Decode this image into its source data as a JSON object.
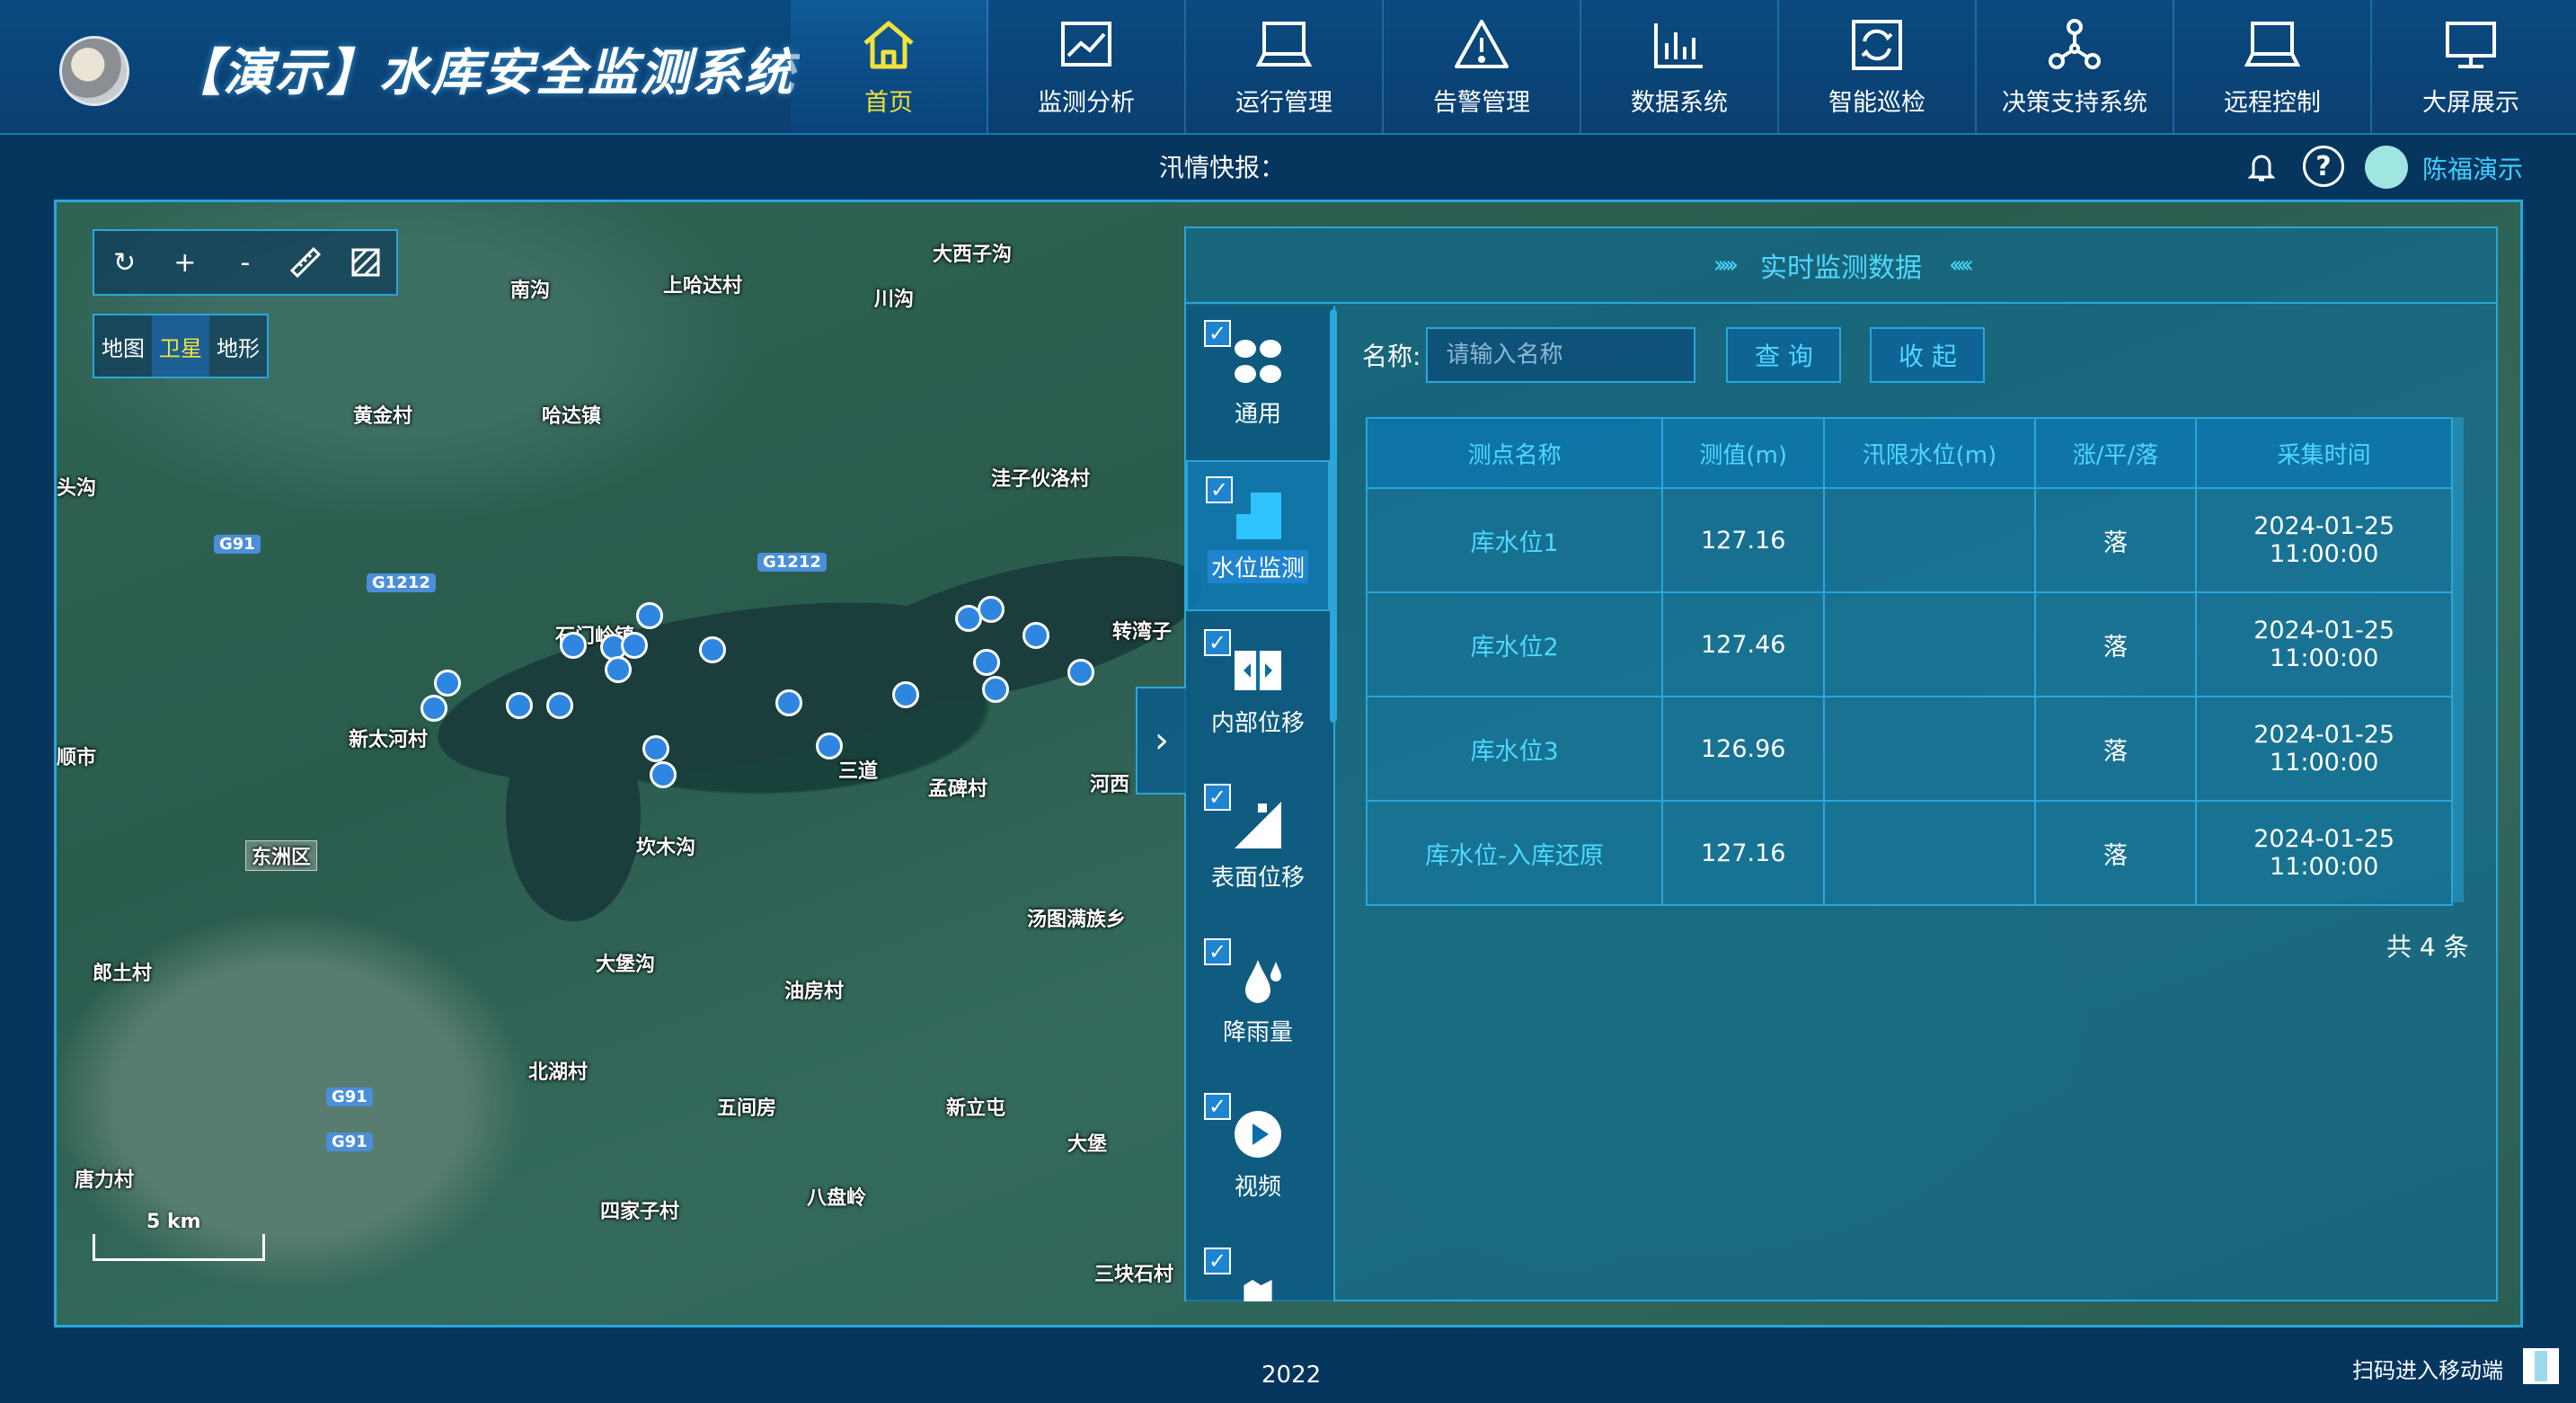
{
  "app": {
    "title": "【演示】水库安全监测系统"
  },
  "nav": [
    {
      "label": "首页",
      "icon": "home-icon",
      "active": true
    },
    {
      "label": "监测分析",
      "icon": "line-chart-icon"
    },
    {
      "label": "运行管理",
      "icon": "laptop-icon"
    },
    {
      "label": "告警管理",
      "icon": "warning-icon"
    },
    {
      "label": "数据系统",
      "icon": "bar-chart-icon"
    },
    {
      "label": "智能巡检",
      "icon": "refresh-icon"
    },
    {
      "label": "决策支持系统",
      "icon": "network-icon"
    },
    {
      "label": "远程控制",
      "icon": "laptop-icon"
    },
    {
      "label": "大屏展示",
      "icon": "monitor-icon"
    }
  ],
  "subbar": {
    "flood_label": "汛情快报：",
    "help_glyph": "?",
    "username": "陈福演示"
  },
  "map": {
    "tools": [
      "↻",
      "+",
      "-"
    ],
    "layers": [
      "地图",
      "卫星",
      "地形"
    ],
    "active_layer": "卫星",
    "scale": "5 km",
    "places": [
      {
        "name": "南沟"
      },
      {
        "name": "上哈达村"
      },
      {
        "name": "大西子沟"
      },
      {
        "name": "川沟"
      },
      {
        "name": "黄金村"
      },
      {
        "name": "哈达镇"
      },
      {
        "name": "洼子伙洛村"
      },
      {
        "name": "头沟"
      },
      {
        "name": "石门岭镇"
      },
      {
        "name": "转湾子"
      },
      {
        "name": "新太河村"
      },
      {
        "name": "三道"
      },
      {
        "name": "孟碑村"
      },
      {
        "name": "河西"
      },
      {
        "name": "东洲区"
      },
      {
        "name": "坎木沟"
      },
      {
        "name": "汤图满族乡"
      },
      {
        "name": "顺市"
      },
      {
        "name": "郎土村"
      },
      {
        "name": "大堡沟"
      },
      {
        "name": "油房村"
      },
      {
        "name": "北湖村"
      },
      {
        "name": "五间房"
      },
      {
        "name": "新立屯"
      },
      {
        "name": "大堡"
      },
      {
        "name": "八盘岭"
      },
      {
        "name": "四家子村"
      },
      {
        "name": "唐力村"
      },
      {
        "name": "三块石村"
      }
    ],
    "roads": [
      "G91",
      "G1212",
      "G1212",
      "G91",
      "G91"
    ]
  },
  "panel": {
    "title": "实时监测数据",
    "toggle_glyph": "›",
    "layer_items": [
      {
        "label": "通用",
        "icon": "grid-icon",
        "checked": true
      },
      {
        "label": "水位监测",
        "icon": "water-level-icon",
        "checked": true,
        "active": true
      },
      {
        "label": "内部位移",
        "icon": "internal-displacement-icon",
        "checked": true
      },
      {
        "label": "表面位移",
        "icon": "surface-displacement-icon",
        "checked": true
      },
      {
        "label": "降雨量",
        "icon": "rainfall-icon",
        "checked": true
      },
      {
        "label": "视频",
        "icon": "play-icon",
        "checked": true
      },
      {
        "label": "",
        "icon": "seepage-icon",
        "checked": true
      }
    ],
    "search": {
      "label": "名称:",
      "placeholder": "请输入名称",
      "query_btn": "查 询",
      "collapse_btn": "收 起"
    },
    "table": {
      "columns": [
        "测点名称",
        "测值(m)",
        "汛限水位(m)",
        "涨/平/落",
        "采集时间"
      ],
      "rows": [
        {
          "name": "库水位1",
          "value": "127.16",
          "limit": "",
          "trend": "落",
          "date": "2024-01-25",
          "time": "11:00:00"
        },
        {
          "name": "库水位2",
          "value": "127.46",
          "limit": "",
          "trend": "落",
          "date": "2024-01-25",
          "time": "11:00:00"
        },
        {
          "name": "库水位3",
          "value": "126.96",
          "limit": "",
          "trend": "落",
          "date": "2024-01-25",
          "time": "11:00:00"
        },
        {
          "name": "库水位-入库还原",
          "value": "127.16",
          "limit": "",
          "trend": "落",
          "date": "2024-01-25",
          "time": "11:00:00"
        }
      ]
    },
    "total": "共 4 条"
  },
  "footer": {
    "year": "2022",
    "mobile": "扫码进入移动端"
  }
}
